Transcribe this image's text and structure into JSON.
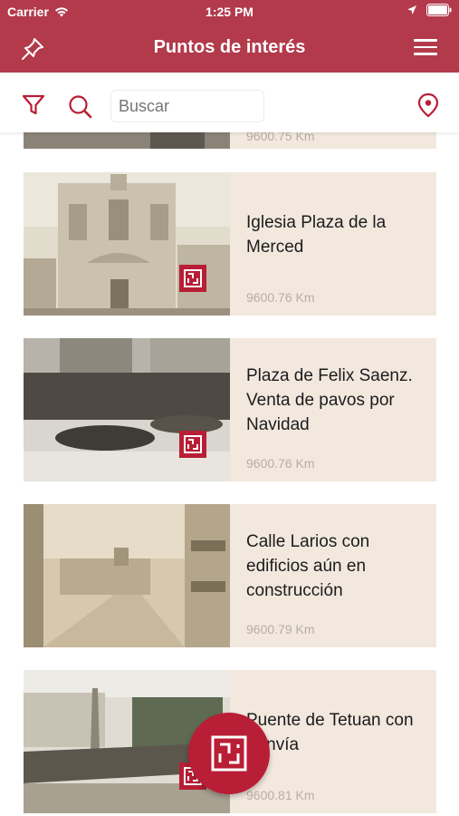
{
  "status": {
    "carrier": "Carrier",
    "time": "1:25 PM"
  },
  "nav": {
    "title": "Puntos de interés",
    "left_icon": "pin-icon",
    "menu_icon": "hamburger-menu-icon"
  },
  "toolbar": {
    "search_placeholder": "Buscar",
    "filter_icon": "filter-icon",
    "search_icon": "search-icon",
    "location_icon": "location-pin-icon"
  },
  "colors": {
    "accent": "#b23a4b",
    "badge": "#b81e35",
    "card_bg": "#f2e8de"
  },
  "items": [
    {
      "name": "",
      "distance": "9600.75 Km"
    },
    {
      "name": "Iglesia Plaza de la Merced",
      "distance": "9600.76 Km"
    },
    {
      "name": "Plaza de Felix Saenz. Venta de pavos por Navidad",
      "distance": "9600.76 Km"
    },
    {
      "name": "Calle Larios con edificios aún en construcción",
      "distance": "9600.79 Km"
    },
    {
      "name": "Puente de Tetuan con tranvía",
      "distance": "9600.81 Km"
    }
  ]
}
